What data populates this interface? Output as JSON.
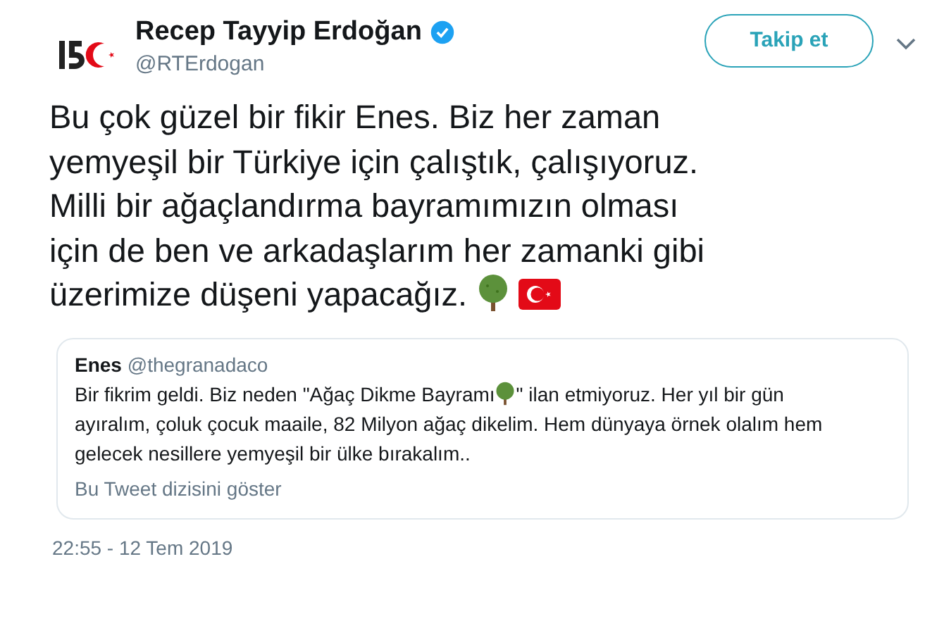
{
  "author": {
    "name": "Recep Tayyip Erdoğan",
    "verified": true,
    "handle": "@RTErdogan"
  },
  "follow_button": "Takip et",
  "tweet_lines": [
    "Bu çok güzel bir fikir Enes. Biz her zaman",
    "yemyeşil bir Türkiye için çalıştık, çalışıyoruz.",
    "Milli bir ağaçlandırma bayramımızın olması",
    "için de ben ve arkadaşlarım her zamanki gibi",
    "üzerimize düşeni yapacağız."
  ],
  "quote": {
    "name": "Enes",
    "handle": "@thegranadaco",
    "text_before": "Bir fikrim geldi. Biz neden \"Ağaç Dikme Bayramı",
    "text_after": "\" ilan etmiyoruz. Her yıl bir gün",
    "more_lines": [
      "ayıralım, çoluk çocuk maaile, 82 Milyon ağaç dikelim. Hem dünyaya örnek olalım hem",
      "gelecek nesillere yemyeşil bir ülke bırakalım.."
    ],
    "thread_link": "Bu Tweet dizisini göster"
  },
  "timestamp": "22:55 - 12 Tem 2019"
}
